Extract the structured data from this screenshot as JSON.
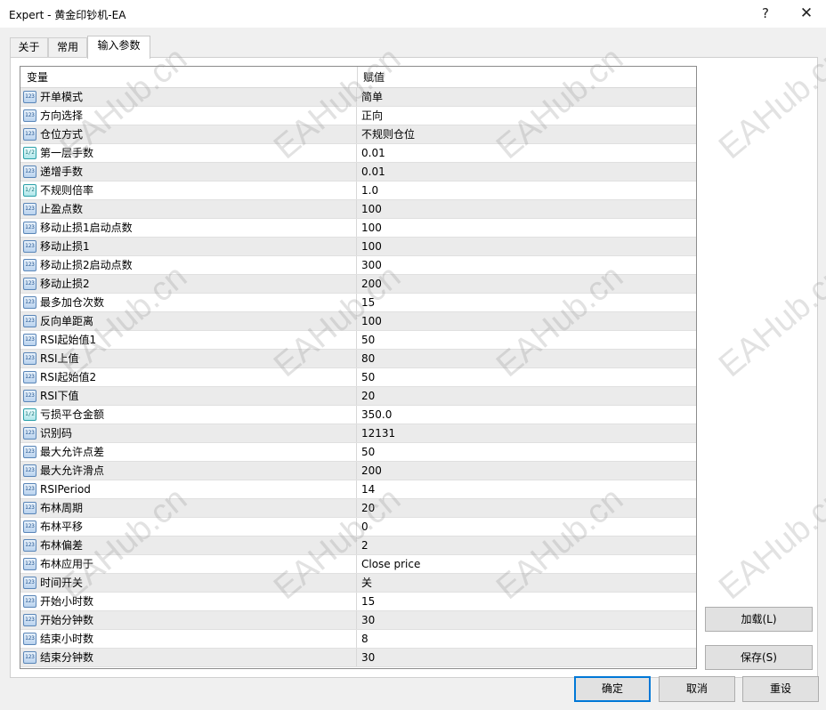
{
  "window": {
    "title": "Expert - 黄金印钞机-EA",
    "help_glyph": "?",
    "close_glyph": "✕"
  },
  "tabs": [
    {
      "label": "关于",
      "active": false
    },
    {
      "label": "常用",
      "active": false
    },
    {
      "label": "输入参数",
      "active": true
    }
  ],
  "grid": {
    "col_variable": "变量",
    "col_value": "赋值",
    "rows": [
      {
        "icon": "int-icon",
        "name": "开单模式",
        "value": "简单"
      },
      {
        "icon": "int-icon",
        "name": "方向选择",
        "value": "正向"
      },
      {
        "icon": "int-icon",
        "name": "仓位方式",
        "value": "不规则仓位"
      },
      {
        "icon": "double-icon",
        "name": "第一层手数",
        "value": "0.01"
      },
      {
        "icon": "int-icon",
        "name": "递增手数",
        "value": "0.01"
      },
      {
        "icon": "double-icon",
        "name": "不规则倍率",
        "value": "1.0"
      },
      {
        "icon": "int-icon",
        "name": "止盈点数",
        "value": "100"
      },
      {
        "icon": "int-icon",
        "name": "移动止损1启动点数",
        "value": "100"
      },
      {
        "icon": "int-icon",
        "name": "移动止损1",
        "value": "100"
      },
      {
        "icon": "int-icon",
        "name": "移动止损2启动点数",
        "value": "300"
      },
      {
        "icon": "int-icon",
        "name": "移动止损2",
        "value": "200"
      },
      {
        "icon": "int-icon",
        "name": "最多加仓次数",
        "value": "15"
      },
      {
        "icon": "int-icon",
        "name": "反向单距离",
        "value": "100"
      },
      {
        "icon": "int-icon",
        "name": "RSI起始值1",
        "value": "50"
      },
      {
        "icon": "int-icon",
        "name": "RSI上值",
        "value": "80"
      },
      {
        "icon": "int-icon",
        "name": "RSI起始值2",
        "value": "50"
      },
      {
        "icon": "int-icon",
        "name": "RSI下值",
        "value": "20"
      },
      {
        "icon": "double-icon",
        "name": "亏损平仓金额",
        "value": "350.0"
      },
      {
        "icon": "int-icon",
        "name": "识别码",
        "value": "12131"
      },
      {
        "icon": "int-icon",
        "name": "最大允许点差",
        "value": "50"
      },
      {
        "icon": "int-icon",
        "name": "最大允许滑点",
        "value": "200"
      },
      {
        "icon": "int-icon",
        "name": "RSIPeriod",
        "value": "14"
      },
      {
        "icon": "int-icon",
        "name": "布林周期",
        "value": "20"
      },
      {
        "icon": "int-icon",
        "name": "布林平移",
        "value": "0"
      },
      {
        "icon": "int-icon",
        "name": "布林偏差",
        "value": "2"
      },
      {
        "icon": "int-icon",
        "name": "布林应用于",
        "value": "Close price"
      },
      {
        "icon": "int-icon",
        "name": "时间开关",
        "value": "关"
      },
      {
        "icon": "int-icon",
        "name": "开始小时数",
        "value": "15"
      },
      {
        "icon": "int-icon",
        "name": "开始分钟数",
        "value": "30"
      },
      {
        "icon": "int-icon",
        "name": "结束小时数",
        "value": "8"
      },
      {
        "icon": "int-icon",
        "name": "结束分钟数",
        "value": "30"
      }
    ]
  },
  "buttons": {
    "load": "加载(L)",
    "save": "保存(S)",
    "ok": "确定",
    "cancel": "取消",
    "reset": "重设"
  },
  "icon_glyphs": {
    "int-icon": "123",
    "double-icon": "1/2"
  },
  "watermark": "EAHub.cn",
  "colors": {
    "accent": "#0078d7",
    "row_alt": "#ebebeb"
  }
}
